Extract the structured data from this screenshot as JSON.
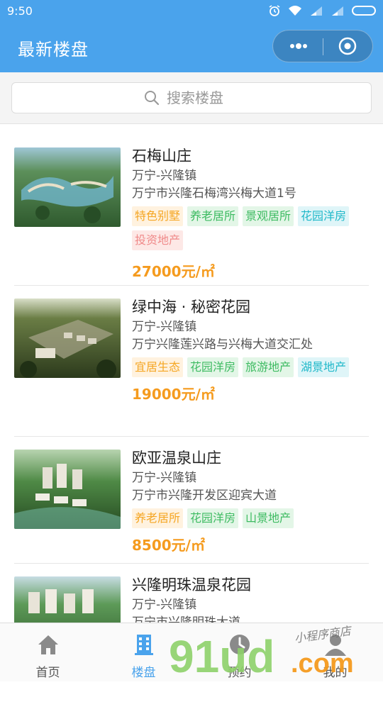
{
  "status_bar": {
    "time": "9:50"
  },
  "header": {
    "title": "最新楼盘"
  },
  "search": {
    "placeholder": "搜索楼盘"
  },
  "properties": [
    {
      "name": "石梅山庄",
      "area": "万宁-兴隆镇",
      "address": "万宁市兴隆石梅湾兴梅大道1号",
      "tags": [
        "特色别墅",
        "养老居所",
        "景观居所",
        "花园洋房",
        "投资地产"
      ],
      "price": "27000元/㎡"
    },
    {
      "name": "绿中海 · 秘密花园",
      "area": "万宁-兴隆镇",
      "address": "万宁兴隆莲兴路与兴梅大道交汇处",
      "tags": [
        "宜居生态",
        "花园洋房",
        "旅游地产",
        "湖景地产"
      ],
      "price": "19000元/㎡"
    },
    {
      "name": "欧亚温泉山庄",
      "area": "万宁-兴隆镇",
      "address": "万宁市兴隆开发区迎宾大道",
      "tags": [
        "养老居所",
        "花园洋房",
        "山景地产"
      ],
      "price": "8500元/㎡"
    },
    {
      "name": "兴隆明珠温泉花园",
      "area": "万宁-兴隆镇",
      "address": "万宁市兴隆明珠大道",
      "tags": [],
      "price": ""
    }
  ],
  "tab_bar": [
    {
      "label": "首页",
      "icon": "home-icon"
    },
    {
      "label": "楼盘",
      "icon": "building-icon",
      "active": true
    },
    {
      "label": "预约",
      "icon": "clock-icon"
    },
    {
      "label": "我的",
      "icon": "user-icon"
    }
  ],
  "watermark": {
    "brand": "91ud.com",
    "slogan": "小程序商店"
  },
  "colors": {
    "header": "#4aa3ec",
    "price": "#f59b1e",
    "tag_orange": "#f5a623",
    "tag_green": "#3dbb61",
    "tag_cyan": "#1fb8c9",
    "tag_pink": "#f08a8a"
  }
}
